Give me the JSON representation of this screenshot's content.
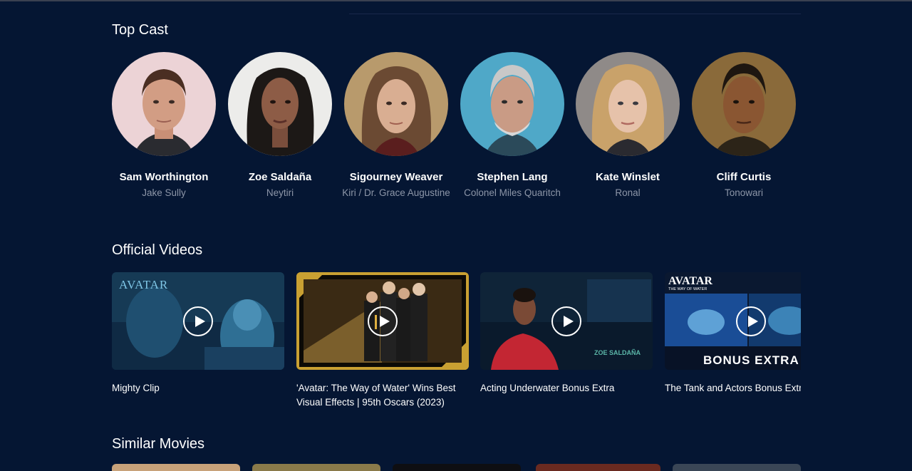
{
  "sections": {
    "top_cast": "Top Cast",
    "official_videos": "Official Videos",
    "similar_movies": "Similar Movies"
  },
  "cast": [
    {
      "name": "Sam Worthington",
      "role": "Jake Sully"
    },
    {
      "name": "Zoe Saldaña",
      "role": "Neytiri"
    },
    {
      "name": "Sigourney Weaver",
      "role": "Kiri / Dr. Grace Augustine"
    },
    {
      "name": "Stephen Lang",
      "role": "Colonel Miles Quaritch"
    },
    {
      "name": "Kate Winslet",
      "role": "Ronal"
    },
    {
      "name": "Cliff Curtis",
      "role": "Tonowari"
    }
  ],
  "videos": [
    {
      "title": "Mighty Clip",
      "overlay": "AVATAR"
    },
    {
      "title": "'Avatar: The Way of Water' Wins Best Visual Effects | 95th Oscars (2023)"
    },
    {
      "title": "Acting Underwater Bonus Extra",
      "overlay": "ZOE SALDAÑA"
    },
    {
      "title": "The Tank and Actors Bonus Extra",
      "overlay": "AVATAR",
      "overlay2": "THE WAY OF WATER",
      "badge": "BONUS EXTRA"
    }
  ],
  "colors": {
    "background": "#051633",
    "muted_text": "#8d96a8"
  }
}
